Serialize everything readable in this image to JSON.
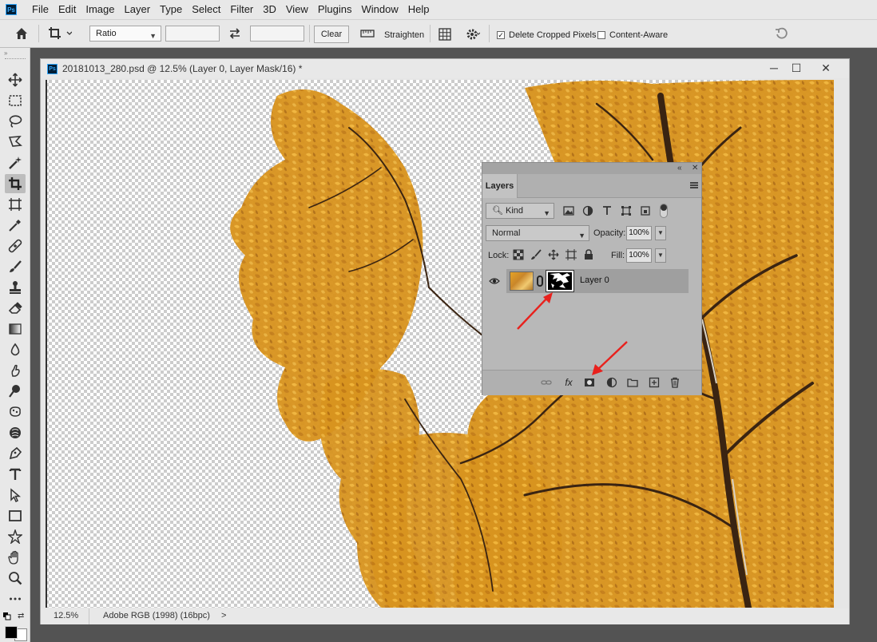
{
  "app": {
    "logo": "Ps"
  },
  "menu": [
    "File",
    "Edit",
    "Image",
    "Layer",
    "Type",
    "Select",
    "Filter",
    "3D",
    "View",
    "Plugins",
    "Window",
    "Help"
  ],
  "options": {
    "ratio_value": "Ratio",
    "clear_label": "Clear",
    "straighten_label": "Straighten",
    "delete_cropped_label": "Delete Cropped Pixels",
    "delete_cropped_checked": true,
    "content_aware_label": "Content-Aware",
    "content_aware_checked": false
  },
  "tools": [
    "move-tool",
    "marquee-tool",
    "lasso-tool",
    "polygonal-lasso-tool",
    "magic-wand-tool",
    "crop-tool",
    "frame-tool",
    "eyedropper-tool",
    "healing-brush-tool",
    "brush-tool",
    "clone-stamp-tool",
    "eraser-tool",
    "gradient-tool",
    "blur-tool",
    "smudge-tool",
    "dodge-tool",
    "sponge-tool",
    "burn-tool",
    "pen-tool",
    "type-tool",
    "path-selection-tool",
    "rectangle-tool",
    "custom-shape-tool",
    "hand-tool",
    "zoom-tool",
    "more-tools"
  ],
  "document": {
    "title": "20181013_280.psd @ 12.5% (Layer 0, Layer Mask/16) *",
    "zoom": "12.5%",
    "profile": "Adobe RGB (1998) (16bpc)",
    "status_arrow": ">"
  },
  "layers_panel": {
    "collapse": "«",
    "close": "✕",
    "tab": "Layers",
    "filter_kind": "Kind",
    "blend_mode": "Normal",
    "opacity_label": "Opacity:",
    "opacity_value": "100%",
    "lock_label": "Lock:",
    "fill_label": "Fill:",
    "fill_value": "100%",
    "layer_name": "Layer 0",
    "fx_label": "fx"
  },
  "annotations": {
    "arrow_color": "#e8211d"
  }
}
